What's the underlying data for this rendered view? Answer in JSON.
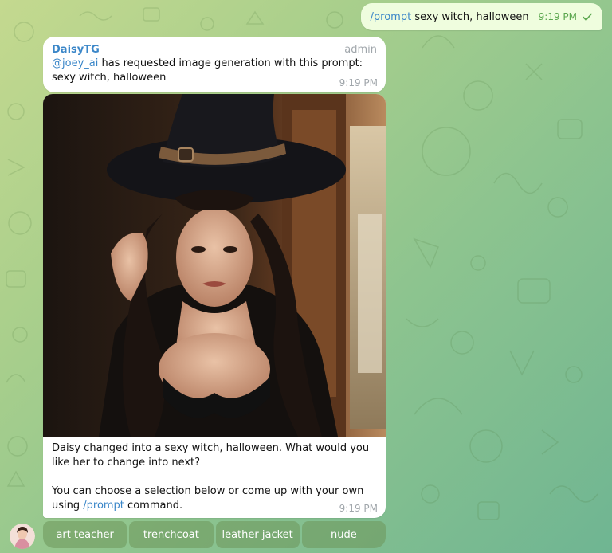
{
  "outgoing": {
    "command": "/prompt",
    "text": " sexy witch, halloween",
    "time": "9:19 PM",
    "status_icon": "check-icon"
  },
  "bot_message": {
    "sender": "DaisyTG",
    "role": "admin",
    "mention": "@joey_ai",
    "text": " has requested image generation with this prompt: sexy witch, halloween",
    "time": "9:19 PM"
  },
  "photo_message": {
    "caption_line1": "Daisy changed into a sexy witch, halloween. What would you like her to change into next?",
    "caption_line2_prefix": "You can choose a selection below or come up with your own using ",
    "caption_command": "/prompt",
    "caption_line2_suffix": " command.",
    "time": "9:19 PM"
  },
  "keyboard": {
    "buttons": [
      {
        "label": "art teacher"
      },
      {
        "label": "trenchcoat"
      },
      {
        "label": "leather jacket"
      },
      {
        "label": "nude"
      }
    ]
  },
  "colors": {
    "link": "#3a86c8",
    "outgoing_bg": "#effdde",
    "outgoing_time": "#5aa64e",
    "meta_gray": "#a0a6ab",
    "keyboard_btn": "#7a9c60"
  }
}
